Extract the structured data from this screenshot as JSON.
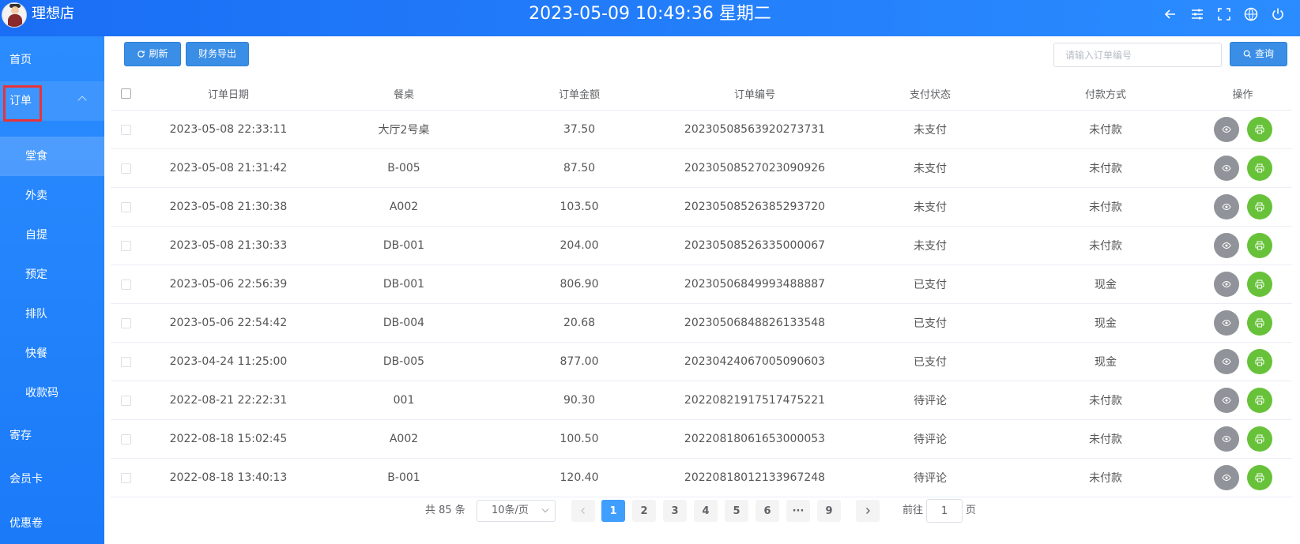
{
  "header": {
    "shop_name": "理想店",
    "clock": "2023-05-09 10:49:36 星期二",
    "icons": [
      "back-arrow-icon",
      "sliders-icon",
      "fullscreen-icon",
      "globe-icon",
      "power-icon"
    ]
  },
  "sidebar": {
    "items": [
      {
        "label": "首页",
        "level": 1
      },
      {
        "label": "订单",
        "level": 1,
        "expanded": true
      },
      {
        "label": "堂食",
        "level": 2,
        "active": true
      },
      {
        "label": "外卖",
        "level": 2
      },
      {
        "label": "自提",
        "level": 2
      },
      {
        "label": "预定",
        "level": 2
      },
      {
        "label": "排队",
        "level": 2
      },
      {
        "label": "快餐",
        "level": 2
      },
      {
        "label": "收款码",
        "level": 2
      },
      {
        "label": "寄存",
        "level": 1
      },
      {
        "label": "会员卡",
        "level": 1
      },
      {
        "label": "优惠卷",
        "level": 1
      }
    ]
  },
  "toolbar": {
    "refresh_label": "刷新",
    "export_label": "财务导出",
    "search_placeholder": "请输入订单编号",
    "search_value": "",
    "query_label": "查询"
  },
  "table": {
    "headers": [
      "订单日期",
      "餐桌",
      "订单金额",
      "订单编号",
      "支付状态",
      "付款方式",
      "操作"
    ],
    "rows": [
      {
        "date": "2023-05-08 22:33:11",
        "table": "大厅2号桌",
        "amount": "37.50",
        "order_no": "20230508563920273731",
        "pay_status": "未支付",
        "pay_method": "未付款"
      },
      {
        "date": "2023-05-08 21:31:42",
        "table": "B-005",
        "amount": "87.50",
        "order_no": "20230508527023090926",
        "pay_status": "未支付",
        "pay_method": "未付款"
      },
      {
        "date": "2023-05-08 21:30:38",
        "table": "A002",
        "amount": "103.50",
        "order_no": "20230508526385293720",
        "pay_status": "未支付",
        "pay_method": "未付款"
      },
      {
        "date": "2023-05-08 21:30:33",
        "table": "DB-001",
        "amount": "204.00",
        "order_no": "20230508526335000067",
        "pay_status": "未支付",
        "pay_method": "未付款"
      },
      {
        "date": "2023-05-06 22:56:39",
        "table": "DB-001",
        "amount": "806.90",
        "order_no": "20230506849993488887",
        "pay_status": "已支付",
        "pay_method": "现金"
      },
      {
        "date": "2023-05-06 22:54:42",
        "table": "DB-004",
        "amount": "20.68",
        "order_no": "20230506848826133548",
        "pay_status": "已支付",
        "pay_method": "现金"
      },
      {
        "date": "2023-04-24 11:25:00",
        "table": "DB-005",
        "amount": "877.00",
        "order_no": "20230424067005090603",
        "pay_status": "已支付",
        "pay_method": "现金"
      },
      {
        "date": "2022-08-21 22:22:31",
        "table": "001",
        "amount": "90.30",
        "order_no": "20220821917517475221",
        "pay_status": "待评论",
        "pay_method": "未付款"
      },
      {
        "date": "2022-08-18 15:02:45",
        "table": "A002",
        "amount": "100.50",
        "order_no": "20220818061653000053",
        "pay_status": "待评论",
        "pay_method": "未付款"
      },
      {
        "date": "2022-08-18 13:40:13",
        "table": "B-001",
        "amount": "120.40",
        "order_no": "20220818012133967248",
        "pay_status": "待评论",
        "pay_method": "未付款"
      }
    ]
  },
  "pagination": {
    "total_text": "共 85 条",
    "page_size": "10条/页",
    "pages": [
      "1",
      "2",
      "3",
      "4",
      "5",
      "6",
      "···",
      "9"
    ],
    "current_page": "1",
    "goto_prefix": "前往",
    "goto_value": "1",
    "goto_suffix": "页"
  },
  "colors": {
    "header_bg": "#1a6ef5",
    "sidebar_bg": "#2b8cff",
    "primary_button": "#3a8ee6",
    "view_action": "#909399",
    "print_action": "#67c23a",
    "active_page": "#409eff",
    "highlight_box": "#e8333a"
  }
}
